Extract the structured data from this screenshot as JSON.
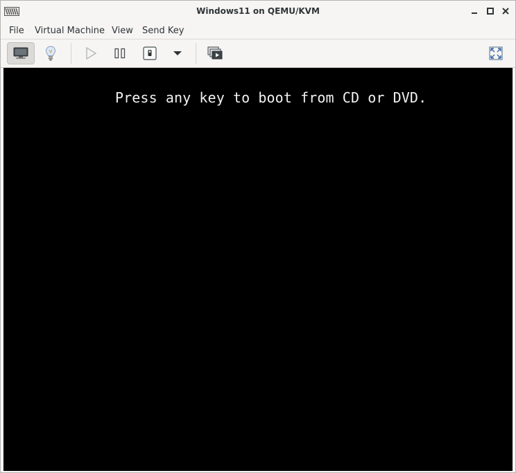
{
  "window": {
    "title": "Windows11 on QEMU/KVM"
  },
  "menubar": {
    "items": [
      {
        "label": "File"
      },
      {
        "label": "Virtual Machine"
      },
      {
        "label": "View"
      },
      {
        "label": "Send Key"
      }
    ]
  },
  "toolbar": {
    "buttons": [
      {
        "icon": "monitor-icon",
        "active": true
      },
      {
        "icon": "lightbulb-icon"
      },
      {
        "icon": "play-icon",
        "enabled": false
      },
      {
        "icon": "pause-icon"
      },
      {
        "icon": "power-icon"
      },
      {
        "icon": "chevron-down-icon"
      },
      {
        "icon": "snapshots-icon"
      },
      {
        "icon": "fullscreen-icon"
      }
    ]
  },
  "console": {
    "text": "Press any key to boot from CD or DVD."
  },
  "colors": {
    "chrome": "#f6f5f4",
    "console_bg": "#000000",
    "console_text": "#f2f2f2"
  }
}
